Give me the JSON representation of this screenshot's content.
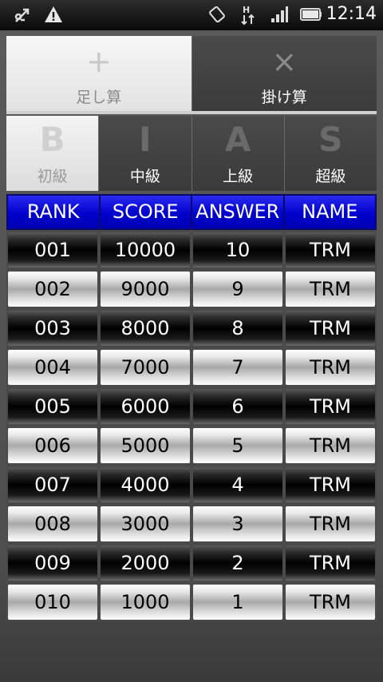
{
  "status_bar": {
    "time": "12:14",
    "icons": [
      "usb-debug-icon",
      "warning-icon",
      "rotate-icon",
      "hspa-data-icon",
      "signal-icon",
      "battery-icon"
    ]
  },
  "operation_tabs": [
    {
      "symbol": "+",
      "label": "足し算",
      "active": true
    },
    {
      "symbol": "×",
      "label": "掛け算",
      "active": false
    }
  ],
  "level_tabs": [
    {
      "letter": "B",
      "label": "初級",
      "active": true
    },
    {
      "letter": "I",
      "label": "中級",
      "active": false
    },
    {
      "letter": "A",
      "label": "上級",
      "active": false
    },
    {
      "letter": "S",
      "label": "超級",
      "active": false
    }
  ],
  "table": {
    "headers": [
      "RANK",
      "SCORE",
      "ANSWER",
      "NAME"
    ],
    "rows": [
      [
        "001",
        "10000",
        "10",
        "TRM"
      ],
      [
        "002",
        "9000",
        "9",
        "TRM"
      ],
      [
        "003",
        "8000",
        "8",
        "TRM"
      ],
      [
        "004",
        "7000",
        "7",
        "TRM"
      ],
      [
        "005",
        "6000",
        "6",
        "TRM"
      ],
      [
        "006",
        "5000",
        "5",
        "TRM"
      ],
      [
        "007",
        "4000",
        "4",
        "TRM"
      ],
      [
        "008",
        "3000",
        "3",
        "TRM"
      ],
      [
        "009",
        "2000",
        "2",
        "TRM"
      ],
      [
        "010",
        "1000",
        "1",
        "TRM"
      ]
    ]
  },
  "colors": {
    "header_blue": "#0000cc",
    "active_tab": "#eeeeee",
    "inactive_tab": "#444444"
  }
}
